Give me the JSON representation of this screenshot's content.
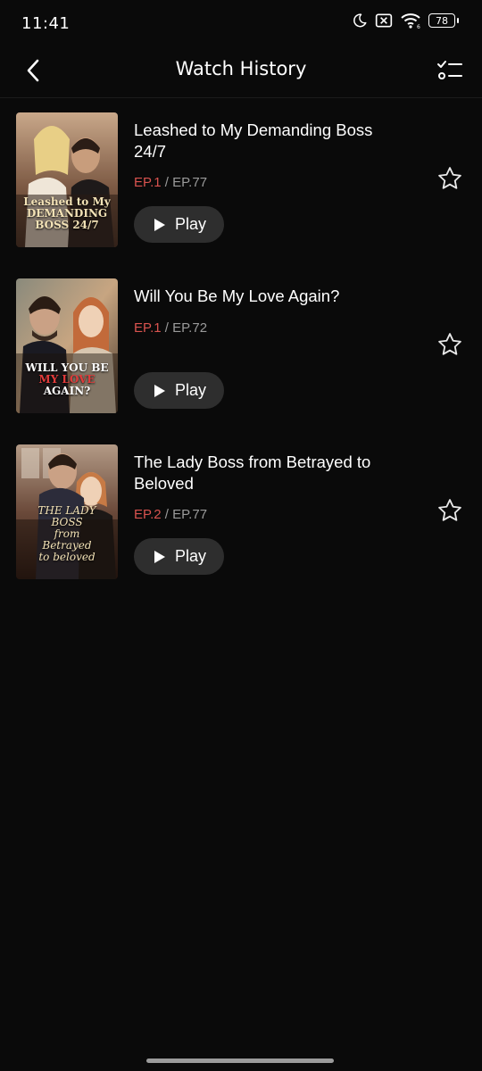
{
  "status_bar": {
    "time": "11:41",
    "battery": "78",
    "icons": [
      "moon-icon",
      "sim-off-icon",
      "wifi-icon",
      "battery-icon"
    ]
  },
  "header": {
    "title": "Watch History",
    "back_icon": "chevron-left-icon",
    "edit_icon": "checklist-icon"
  },
  "colors": {
    "background": "#0a0a0a",
    "accent_red": "#d9534f",
    "muted_text": "#9a9a9a",
    "button_bg": "#2e2e2e"
  },
  "items": [
    {
      "title": "Leashed to My Demanding Boss 24/7",
      "current_episode": "EP.1",
      "separator": "/",
      "total_episodes": "EP.77",
      "play_label": "Play",
      "favorited": false
    },
    {
      "title": "Will You Be My Love Again?",
      "current_episode": "EP.1",
      "separator": "/",
      "total_episodes": "EP.72",
      "play_label": "Play",
      "favorited": false
    },
    {
      "title": "The Lady Boss from Betrayed to Beloved",
      "current_episode": "EP.2",
      "separator": "/",
      "total_episodes": "EP.77",
      "play_label": "Play",
      "favorited": false
    }
  ]
}
